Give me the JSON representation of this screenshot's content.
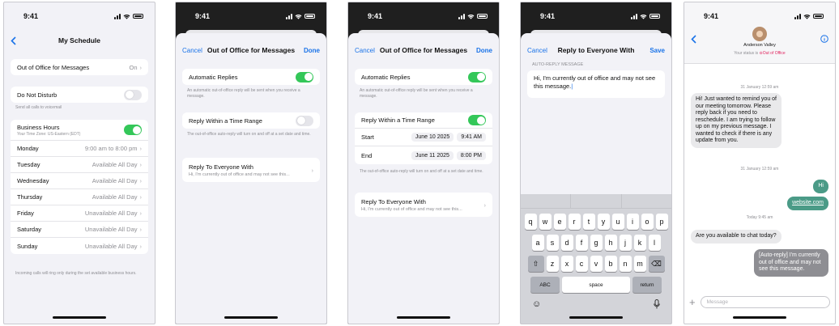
{
  "status": {
    "time": "9:41"
  },
  "screen1": {
    "title": "My Schedule",
    "ooo_label": "Out of Office for Messages",
    "ooo_value": "On",
    "dnd_label": "Do Not Disturb",
    "dnd_note": "Send all calls to voicemail",
    "bh_label": "Business Hours",
    "bh_sub": "Your Time Zone: US-Eastern (EDT)",
    "days": [
      {
        "day": "Monday",
        "value": "9:00 am to 8:00 pm"
      },
      {
        "day": "Tuesday",
        "value": "Available All Day"
      },
      {
        "day": "Wednesday",
        "value": "Available All Day"
      },
      {
        "day": "Thursday",
        "value": "Available All Day"
      },
      {
        "day": "Friday",
        "value": "Unavailable All Day"
      },
      {
        "day": "Saturday",
        "value": "Unavailable All Day"
      },
      {
        "day": "Sunday",
        "value": "Unavailable All Day"
      }
    ],
    "footnote": "Incoming calls will ring only during the set available business hours."
  },
  "screen2": {
    "cancel": "Cancel",
    "title": "Out of Office for Messages",
    "done": "Done",
    "auto_label": "Automatic Replies",
    "auto_note": "An automatic out-of-office reply will be sent when you receive a message.",
    "range_label": "Reply Within a Time Range",
    "range_note": "The out-of-office auto-reply will turn on and off at a set date and time.",
    "reply_label": "Reply To Everyone With",
    "reply_preview": "Hi, I'm currently out of office and may not see this..."
  },
  "screen3": {
    "cancel": "Cancel",
    "title": "Out of Office for Messages",
    "done": "Done",
    "auto_label": "Automatic Replies",
    "auto_note": "An automatic out-of-office reply will be sent when you receive a message.",
    "range_label": "Reply Within a Time Range",
    "start_label": "Start",
    "start_date": "June 10 2025",
    "start_time": "9:41 AM",
    "end_label": "End",
    "end_date": "June 11 2025",
    "end_time": "8:00 PM",
    "range_note": "The out-of-office auto-reply will turn on and off at a set date and time.",
    "reply_label": "Reply To Everyone With",
    "reply_preview": "Hi, I'm currently out of office and may not see this..."
  },
  "screen4": {
    "cancel": "Cancel",
    "title": "Reply to Everyone With",
    "save": "Save",
    "section": "AUTO-REPLY MESSAGE",
    "message": "Hi, I'm currently out of office and may not see this message.",
    "keyboard": {
      "row1": [
        "q",
        "w",
        "e",
        "r",
        "t",
        "y",
        "u",
        "i",
        "o",
        "p"
      ],
      "row2": [
        "a",
        "s",
        "d",
        "f",
        "g",
        "h",
        "j",
        "k",
        "l"
      ],
      "row3": [
        "z",
        "x",
        "c",
        "v",
        "b",
        "n",
        "m"
      ],
      "abc": "ABC",
      "space": "space",
      "return": "return"
    }
  },
  "screen5": {
    "contact": "Anderson Valley",
    "status_prefix": "Your status is",
    "status_value": "Out of Office",
    "stamp1": "31 January 12:59 am",
    "msg1": "Hi! Just wanted to remind you of our meeting tomorrow. Please reply back if you need to reschedule. I am trying to follow up on my previous message. I wanted to check if there is any update from you.",
    "stamp2": "31 January 12:59 am",
    "out1": "Hi",
    "out2": "website.com",
    "stamp3": "Today 9:45 am",
    "msg2": "Are you available to chat today?",
    "auto_reply": "[Auto-reply] I'm currently out of office and may not see this message.",
    "input_placeholder": "Message"
  },
  "colors": {
    "accent": "#1a73e8",
    "toggle_on": "#34c759",
    "bubble_out": "#4b9b87",
    "ooo_red": "#e0245e"
  }
}
